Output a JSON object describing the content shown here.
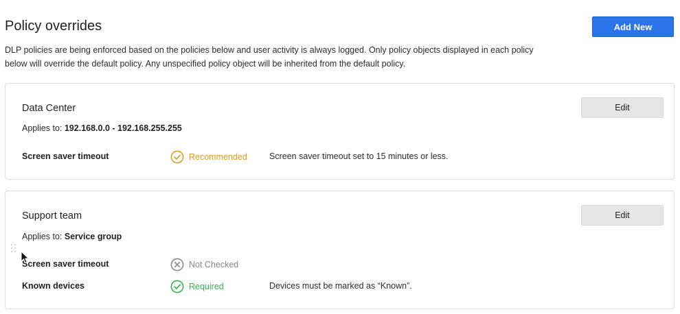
{
  "header": {
    "title": "Policy overrides",
    "add_new_label": "Add New",
    "description": "DLP policies are being enforced based on the policies below and user activity is always logged. Only policy objects displayed in each policy below will override the default policy. Any unspecified policy object will be inherited from the default policy."
  },
  "colors": {
    "accent": "#2a73e8",
    "recommended": "#e49a14",
    "not_checked": "#888888",
    "required": "#2fb84a"
  },
  "policies": [
    {
      "name": "Data Center",
      "applies_prefix": "Applies to:",
      "applies_value": "192.168.0.0 - 192.168.255.255",
      "edit_label": "Edit",
      "rules": [
        {
          "label": "Screen saver timeout",
          "status": "Recommended",
          "status_icon": "check-circle-icon",
          "description": "Screen saver timeout set to 15 minutes or less."
        }
      ]
    },
    {
      "name": "Support team",
      "applies_prefix": "Applies to:",
      "applies_value": "Service group",
      "edit_label": "Edit",
      "rules": [
        {
          "label": "Screen saver timeout",
          "status": "Not Checked",
          "status_icon": "x-circle-icon",
          "description": ""
        },
        {
          "label": "Known devices",
          "status": "Required",
          "status_icon": "check-circle-icon",
          "description": "Devices must be marked as “Known”."
        }
      ]
    }
  ]
}
